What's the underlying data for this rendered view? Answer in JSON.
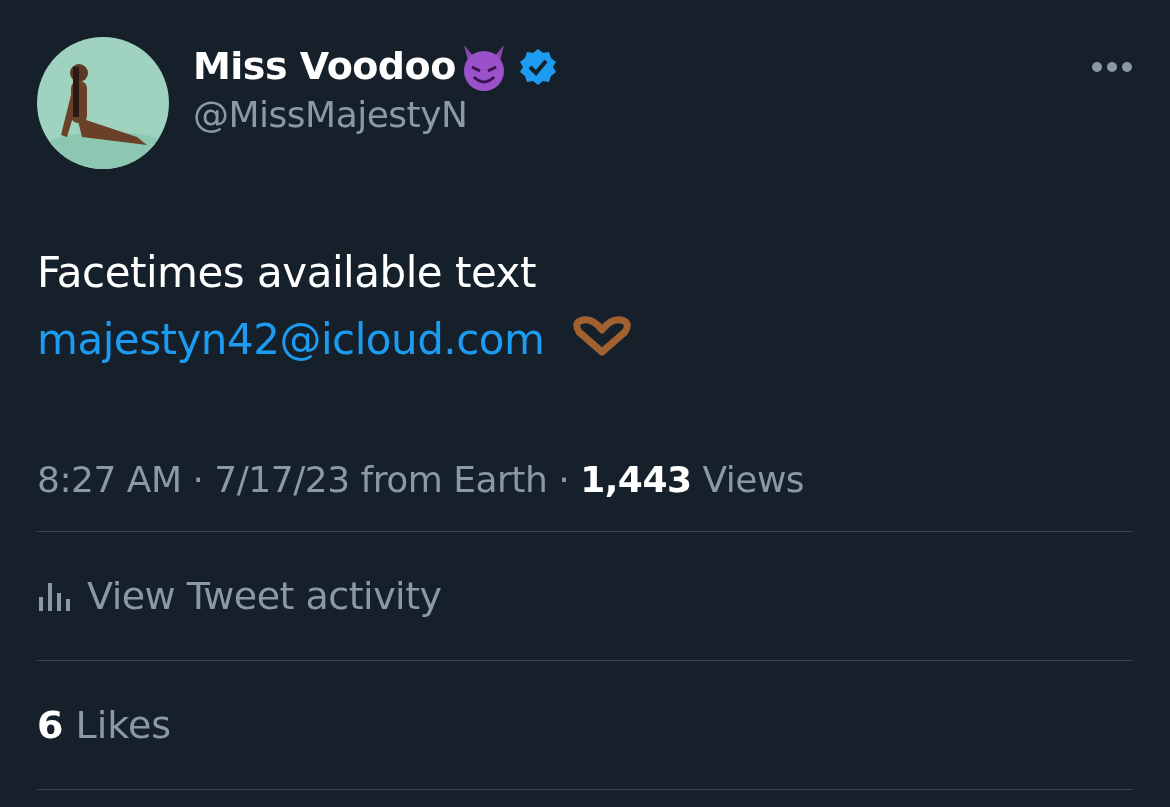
{
  "author": {
    "name": "Miss Voodoo",
    "handle": "@MissMajestyN",
    "verified": true
  },
  "tweet": {
    "text": "Facetimes available text",
    "link": "majestyn42@icloud.com"
  },
  "meta": "8:27 AM · 7/17/23 from Earth · **1,443** Views",
  "activity": "View Tweet activity",
  "likes": "**6** Likes"
}
